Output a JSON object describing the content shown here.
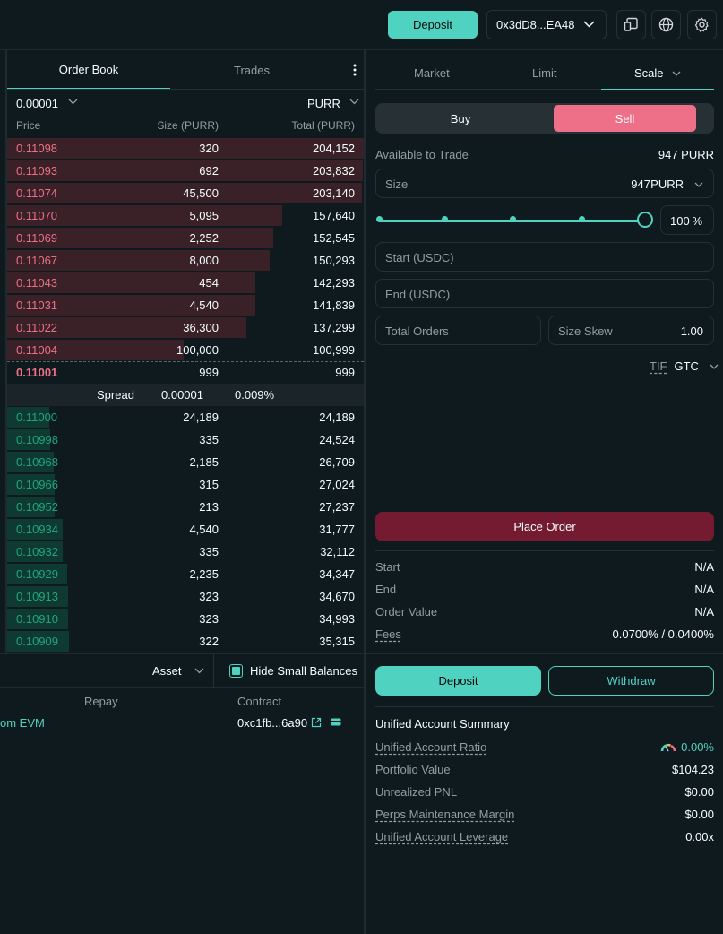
{
  "topbar": {
    "deposit_label": "Deposit",
    "wallet_address": "0x3dD8...EA48",
    "icons": [
      "portfolio-icon",
      "globe-icon",
      "gear-icon"
    ]
  },
  "orderbook": {
    "tabs": [
      "Order Book",
      "Trades"
    ],
    "tick_size": "0.00001",
    "coin": "PURR",
    "headers": {
      "price": "Price",
      "size": "Size (PURR)",
      "total": "Total (PURR)"
    },
    "asks": [
      {
        "price": "0.11098",
        "size": "320",
        "total": "204,152",
        "depth": 1.0
      },
      {
        "price": "0.11093",
        "size": "692",
        "total": "203,832",
        "depth": 0.998
      },
      {
        "price": "0.11074",
        "size": "45,500",
        "total": "203,140",
        "depth": 0.995
      },
      {
        "price": "0.11070",
        "size": "5,095",
        "total": "157,640",
        "depth": 0.772
      },
      {
        "price": "0.11069",
        "size": "2,252",
        "total": "152,545",
        "depth": 0.747
      },
      {
        "price": "0.11067",
        "size": "8,000",
        "total": "150,293",
        "depth": 0.736
      },
      {
        "price": "0.11043",
        "size": "454",
        "total": "142,293",
        "depth": 0.697
      },
      {
        "price": "0.11031",
        "size": "4,540",
        "total": "141,839",
        "depth": 0.695
      },
      {
        "price": "0.11022",
        "size": "36,300",
        "total": "137,299",
        "depth": 0.672
      },
      {
        "price": "0.11004",
        "size": "100,000",
        "total": "100,999",
        "depth": 0.495
      }
    ],
    "mid": {
      "price": "0.11001",
      "size": "999",
      "total": "999"
    },
    "spread": {
      "label": "Spread",
      "value": "0.00001",
      "percent": "0.009%"
    },
    "bids": [
      {
        "price": "0.11000",
        "size": "24,189",
        "total": "24,189",
        "depth": 0.118
      },
      {
        "price": "0.10998",
        "size": "335",
        "total": "24,524",
        "depth": 0.12
      },
      {
        "price": "0.10968",
        "size": "2,185",
        "total": "26,709",
        "depth": 0.131
      },
      {
        "price": "0.10966",
        "size": "315",
        "total": "27,024",
        "depth": 0.132
      },
      {
        "price": "0.10952",
        "size": "213",
        "total": "27,237",
        "depth": 0.133
      },
      {
        "price": "0.10934",
        "size": "4,540",
        "total": "31,777",
        "depth": 0.156
      },
      {
        "price": "0.10932",
        "size": "335",
        "total": "32,112",
        "depth": 0.157
      },
      {
        "price": "0.10929",
        "size": "2,235",
        "total": "34,347",
        "depth": 0.168
      },
      {
        "price": "0.10913",
        "size": "323",
        "total": "34,670",
        "depth": 0.17
      },
      {
        "price": "0.10910",
        "size": "323",
        "total": "34,993",
        "depth": 0.171
      },
      {
        "price": "0.10909",
        "size": "322",
        "total": "35,315",
        "depth": 0.173
      }
    ]
  },
  "balances": {
    "asset_label": "Asset",
    "hide_small_label": "Hide Small Balances",
    "hide_small_checked": true,
    "col_repay": "Repay",
    "col_contract": "Contract",
    "row_partial": "om EVM",
    "contract": "0xc1fb...6a90"
  },
  "tradeform": {
    "tabs": [
      "Market",
      "Limit",
      "Scale"
    ],
    "active_tab": "Scale",
    "buy_label": "Buy",
    "sell_label": "Sell",
    "available_label": "Available to Trade",
    "available_value": "947 PURR",
    "size_label": "Size",
    "size_value": "947",
    "size_unit": "PURR",
    "slider_percent": "100",
    "percent_sign": "%",
    "start_placeholder": "Start (USDC)",
    "end_placeholder": "End (USDC)",
    "total_orders_placeholder": "Total Orders",
    "size_skew_label": "Size Skew",
    "size_skew_value": "1.00",
    "tif_label": "TIF",
    "tif_value": "GTC",
    "place_order_label": "Place Order",
    "summary": [
      {
        "k": "Start",
        "v": "N/A"
      },
      {
        "k": "End",
        "v": "N/A"
      },
      {
        "k": "Order Value",
        "v": "N/A"
      },
      {
        "k": "Fees",
        "v": "0.0700% / 0.0400%"
      }
    ]
  },
  "account": {
    "deposit_label": "Deposit",
    "withdraw_label": "Withdraw",
    "title": "Unified Account Summary",
    "rows": [
      {
        "k": "Unified Account Ratio",
        "v": "0.00%"
      },
      {
        "k": "Portfolio Value",
        "v": "$104.23"
      },
      {
        "k": "Unrealized PNL",
        "v": "$0.00"
      },
      {
        "k": "Perps Maintenance Margin",
        "v": "$0.00"
      },
      {
        "k": "Unified Account Leverage",
        "v": "0.00x"
      }
    ]
  },
  "colors": {
    "accent": "#50d2c1",
    "ask": "#ed7088",
    "bid": "#1fa67d",
    "place_order": "#741a31"
  }
}
